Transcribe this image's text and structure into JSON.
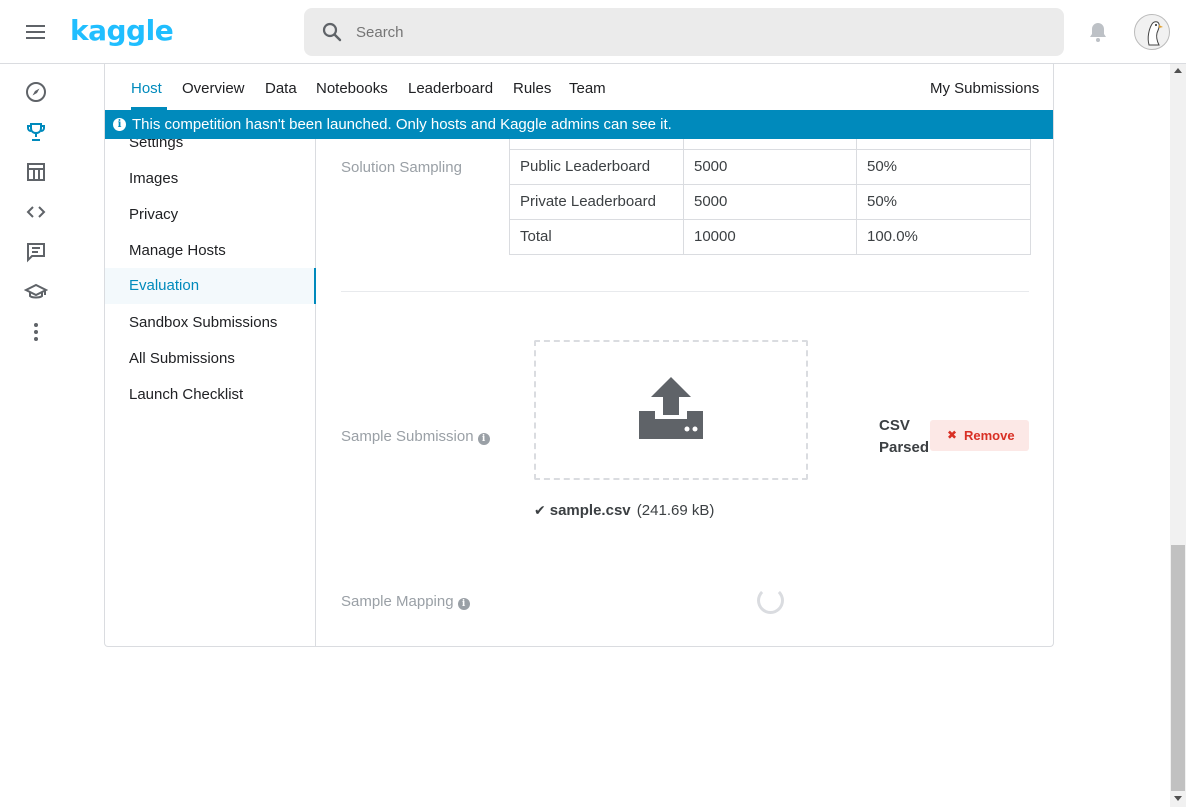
{
  "header": {
    "logo_text": "kaggle",
    "search_placeholder": "Search"
  },
  "tabs": {
    "host": "Host",
    "overview": "Overview",
    "data": "Data",
    "notebooks": "Notebooks",
    "leaderboard": "Leaderboard",
    "rules": "Rules",
    "team": "Team",
    "my_submissions": "My Submissions"
  },
  "banner": {
    "text": "This competition hasn't been launched. Only hosts and Kaggle admins can see it."
  },
  "sidebar": {
    "items": [
      {
        "label": "Settings"
      },
      {
        "label": "Images"
      },
      {
        "label": "Privacy"
      },
      {
        "label": "Manage Hosts"
      },
      {
        "label": "Evaluation"
      },
      {
        "label": "Sandbox Submissions"
      },
      {
        "label": "All Submissions"
      },
      {
        "label": "Launch Checklist"
      }
    ],
    "active": "Evaluation"
  },
  "solution_sampling": {
    "label": "Solution Sampling",
    "rows": [
      {
        "name": "Public Leaderboard",
        "count": "5000",
        "percent": "50%"
      },
      {
        "name": "Private Leaderboard",
        "count": "5000",
        "percent": "50%"
      },
      {
        "name": "Total",
        "count": "10000",
        "percent": "100.0%"
      }
    ]
  },
  "sample_submission": {
    "label": "Sample Submission",
    "status": "CSV Parsed",
    "remove_label": "Remove",
    "file_name": "sample.csv",
    "file_size": "(241.69 kB)"
  },
  "sample_mapping": {
    "label": "Sample Mapping"
  },
  "colors": {
    "brand": "#20beff",
    "accent": "#008abc",
    "remove_text": "#d93025",
    "remove_bg": "#fce8e6"
  }
}
